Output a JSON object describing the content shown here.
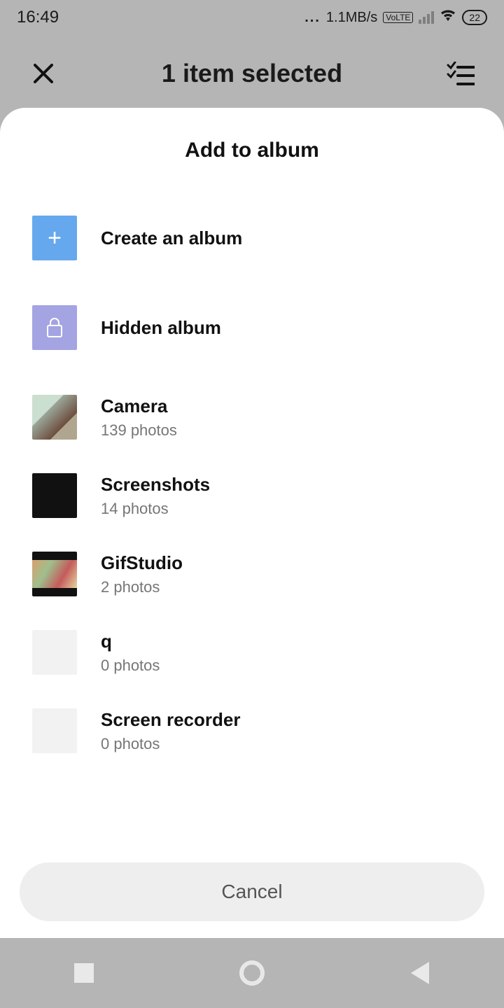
{
  "status": {
    "time": "16:49",
    "speed": "1.1MB/s",
    "battery": "22"
  },
  "appbar": {
    "title": "1 item selected"
  },
  "sheet": {
    "title": "Add to album",
    "create_label": "Create an album",
    "hidden_label": "Hidden album",
    "cancel_label": "Cancel",
    "albums": [
      {
        "name": "Camera",
        "count": "139 photos"
      },
      {
        "name": "Screenshots",
        "count": "14 photos"
      },
      {
        "name": "GifStudio",
        "count": "2 photos"
      },
      {
        "name": "q",
        "count": "0 photos"
      },
      {
        "name": "Screen recorder",
        "count": "0 photos"
      }
    ]
  }
}
